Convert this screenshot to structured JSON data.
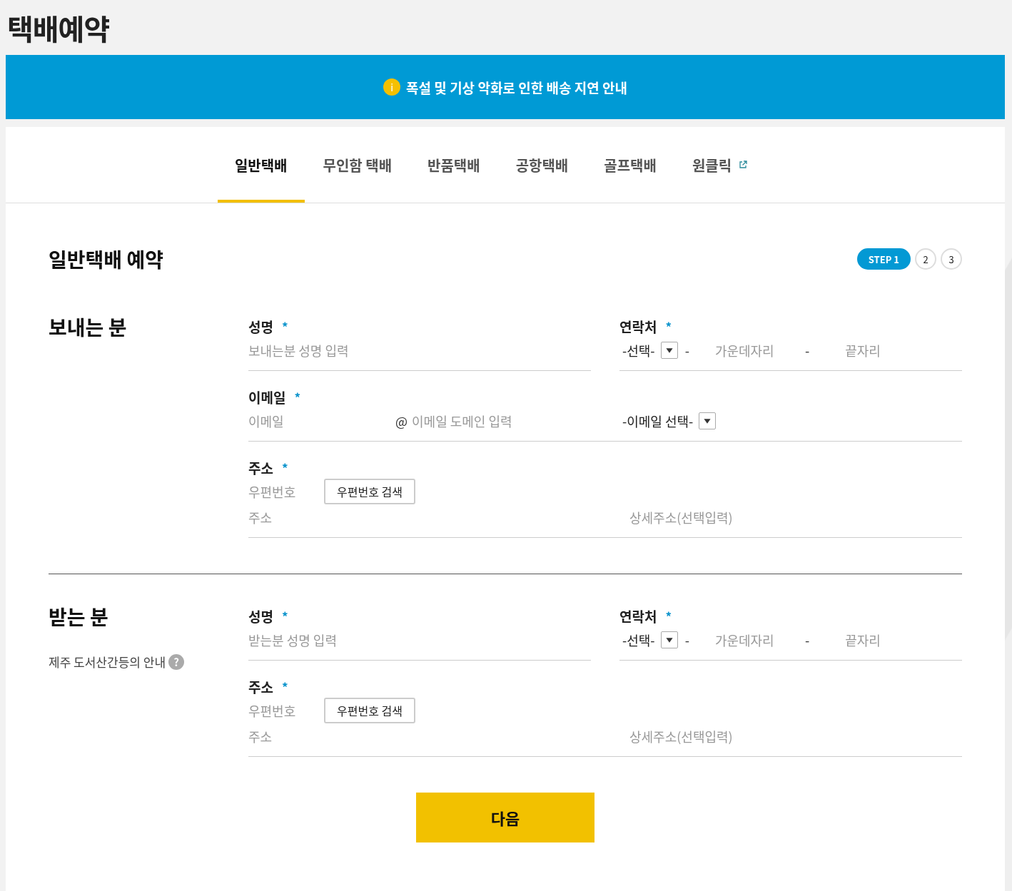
{
  "page_title": "택배예약",
  "notice": {
    "icon_text": "i",
    "text": "폭설 및 기상 악화로 인한 배송 지연 안내"
  },
  "tabs": [
    {
      "label": "일반택배",
      "selected": true,
      "external": false
    },
    {
      "label": "무인함 택배",
      "selected": false,
      "external": false
    },
    {
      "label": "반품택배",
      "selected": false,
      "external": false
    },
    {
      "label": "공항택배",
      "selected": false,
      "external": false
    },
    {
      "label": "골프택배",
      "selected": false,
      "external": false
    },
    {
      "label": "원클릭",
      "selected": false,
      "external": true
    }
  ],
  "form_title": "일반택배 예약",
  "steps": [
    {
      "label": "STEP 1",
      "selected": true
    },
    {
      "label": "2",
      "selected": false
    },
    {
      "label": "3",
      "selected": false
    }
  ],
  "sections": [
    {
      "title": "보내는 분",
      "name": {
        "label": "성명",
        "mark": "*",
        "placeholder": "보내는분 성명 입력"
      },
      "phone": {
        "label": "연락처",
        "mark": "*",
        "select": "-선택-",
        "separator_1": "-",
        "middle_placeholder": "가운데자리",
        "separator_2": "-",
        "last_placeholder": "끝자리"
      },
      "email": {
        "label": "이메일",
        "mark": "*",
        "local_placeholder": "이메일",
        "at": "@",
        "domain_placeholder": "이메일 도메인 입력",
        "select": "-이메일 선택-"
      },
      "address": {
        "label": "주소",
        "mark": "*",
        "zip_placeholder": "우편번호",
        "search_button": "우편번호 검색",
        "address_placeholder": "주소",
        "detail_placeholder": "상세주소(선택입력)"
      }
    },
    {
      "title": "받는 분",
      "note": {
        "text": "제주 도서산간등의 안내",
        "icon_text": "?"
      },
      "name": {
        "label": "성명",
        "mark": "*",
        "placeholder": "받는분 성명 입력"
      },
      "phone": {
        "label": "연락처",
        "mark": "*",
        "select": "-선택-",
        "separator_1": "-",
        "middle_placeholder": "가운데자리",
        "separator_2": "-",
        "last_placeholder": "끝자리"
      },
      "address": {
        "label": "주소",
        "mark": "*",
        "zip_placeholder": "우편번호",
        "search_button": "우편번호 검색",
        "address_placeholder": "주소",
        "detail_placeholder": "상세주소(선택입력)"
      }
    }
  ],
  "next_button": "다음"
}
